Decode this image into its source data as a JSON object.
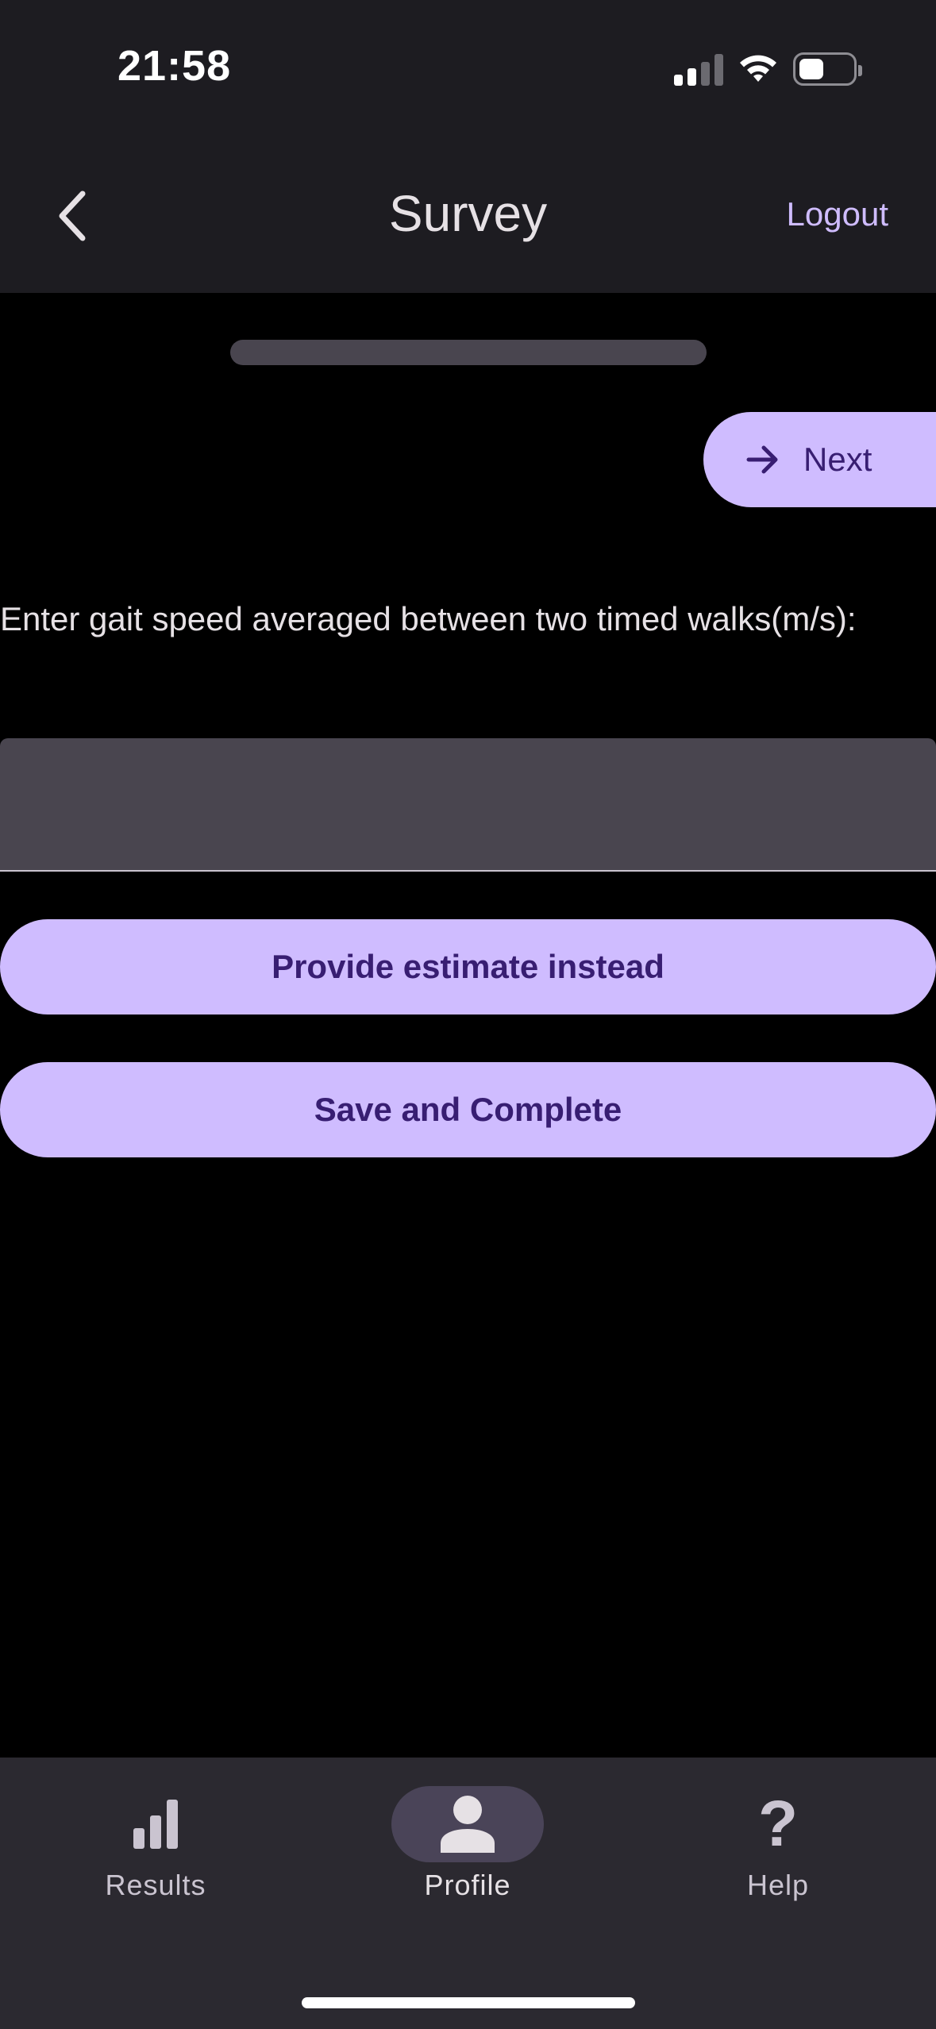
{
  "status_bar": {
    "time": "21:58"
  },
  "header": {
    "title": "Survey",
    "logout_label": "Logout"
  },
  "progress": {
    "fraction": 0.0
  },
  "next_button": {
    "label": "Next"
  },
  "question": {
    "text": "Enter gait speed averaged between two timed walks(m/s):",
    "value": ""
  },
  "buttons": {
    "estimate_label": "Provide estimate instead",
    "save_label": "Save and Complete"
  },
  "bottom_nav": {
    "items": [
      {
        "label": "Results",
        "icon": "bar-chart-icon",
        "active": false
      },
      {
        "label": "Profile",
        "icon": "person-icon",
        "active": true
      },
      {
        "label": "Help",
        "icon": "question-mark-icon",
        "active": false
      }
    ]
  },
  "colors": {
    "accent": "#cfbcff",
    "on_accent": "#381e72",
    "header_bg": "#1d1c21",
    "nav_bg": "#2b2930",
    "input_bg": "#49454f",
    "background": "#000000"
  }
}
